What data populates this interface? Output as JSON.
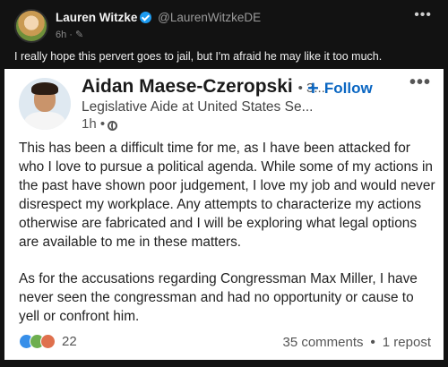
{
  "tweet": {
    "author_name": "Lauren Witzke",
    "handle": "@LaurenWitzkeDE",
    "time": "6h",
    "more_label": "•••",
    "text": "I really hope this pervert goes to jail, but I'm afraid he may like it too much."
  },
  "linkedin_post": {
    "name": "Aidan Maese-Czeropski",
    "degree": "• 3...",
    "follow_label": "Follow",
    "follow_plus": "+",
    "more_label": "•••",
    "subtitle": "Legislative Aide at United States Se...",
    "time": "1h •",
    "body_paragraphs": [
      "This has been a difficult time for me, as I have been attacked for who I love to pursue a political agenda. While some of my actions in the past have shown poor judgement, I love my job and would never disrespect my workplace. Any attempts to characterize my actions otherwise are fabricated and I will be exploring what legal options are available to me in these matters.",
      "As for the accusations regarding Congressman Max Miller, I have never seen the congressman and had no opportunity or cause to yell or confront him."
    ],
    "reaction_count": "22",
    "comments": "35 comments",
    "separator": "•",
    "reposts": "1 repost"
  },
  "icons": {
    "verified": "verified-badge-icon",
    "globe": "globe-icon",
    "reactions": [
      "like-icon",
      "celebrate-icon",
      "love-icon"
    ]
  },
  "colors": {
    "background": "#121212",
    "card": "#ffffff",
    "verified": "#1d9bf0",
    "follow": "#0a66c2"
  }
}
